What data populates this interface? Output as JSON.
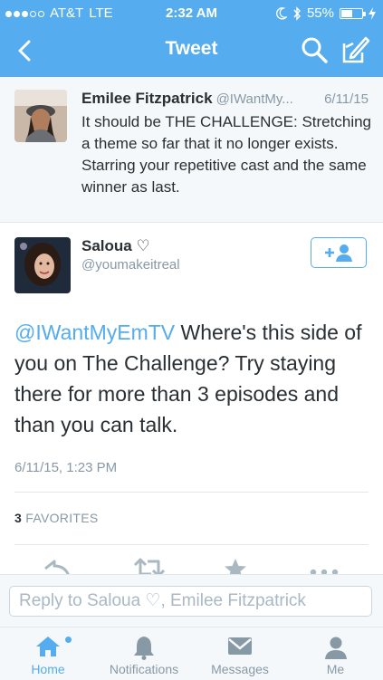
{
  "status_bar": {
    "carrier": "AT&T",
    "network": "LTE",
    "time": "2:32 AM",
    "battery": "55%",
    "battery_level": 0.55
  },
  "nav": {
    "title": "Tweet",
    "icons": [
      "back-chevron-icon",
      "search-icon",
      "compose-icon"
    ]
  },
  "parent_tweet": {
    "name": "Emilee Fitzpatrick",
    "handle": "@IWantMy...",
    "date": "6/11/15",
    "text": "It should be THE CHALLENGE: Stretching a theme so far that it no longer exists. Starring your repetitive cast and the same winner as last."
  },
  "main_tweet": {
    "name": "Saloua ♡",
    "handle": "@youmakeitreal",
    "mention": "@IWantMyEmTV",
    "text": " Where's this side of you on The Challenge? Try staying there for more than 3 episodes and than you can talk.",
    "timestamp": "6/11/15, 1:23 PM",
    "favorites_count": "3",
    "favorites_label": "FAVORITES"
  },
  "reply": {
    "placeholder": "Reply to Saloua ♡, Emilee Fitzpatrick"
  },
  "tabbar": {
    "items": [
      {
        "label": "Home",
        "icon": "home-icon",
        "active": true
      },
      {
        "label": "Notifications",
        "icon": "bell-icon",
        "active": false
      },
      {
        "label": "Messages",
        "icon": "envelope-icon",
        "active": false
      },
      {
        "label": "Me",
        "icon": "person-icon",
        "active": false
      }
    ]
  },
  "colors": {
    "brand": "#55acee",
    "text": "#292f33",
    "muted": "#8899a6"
  }
}
